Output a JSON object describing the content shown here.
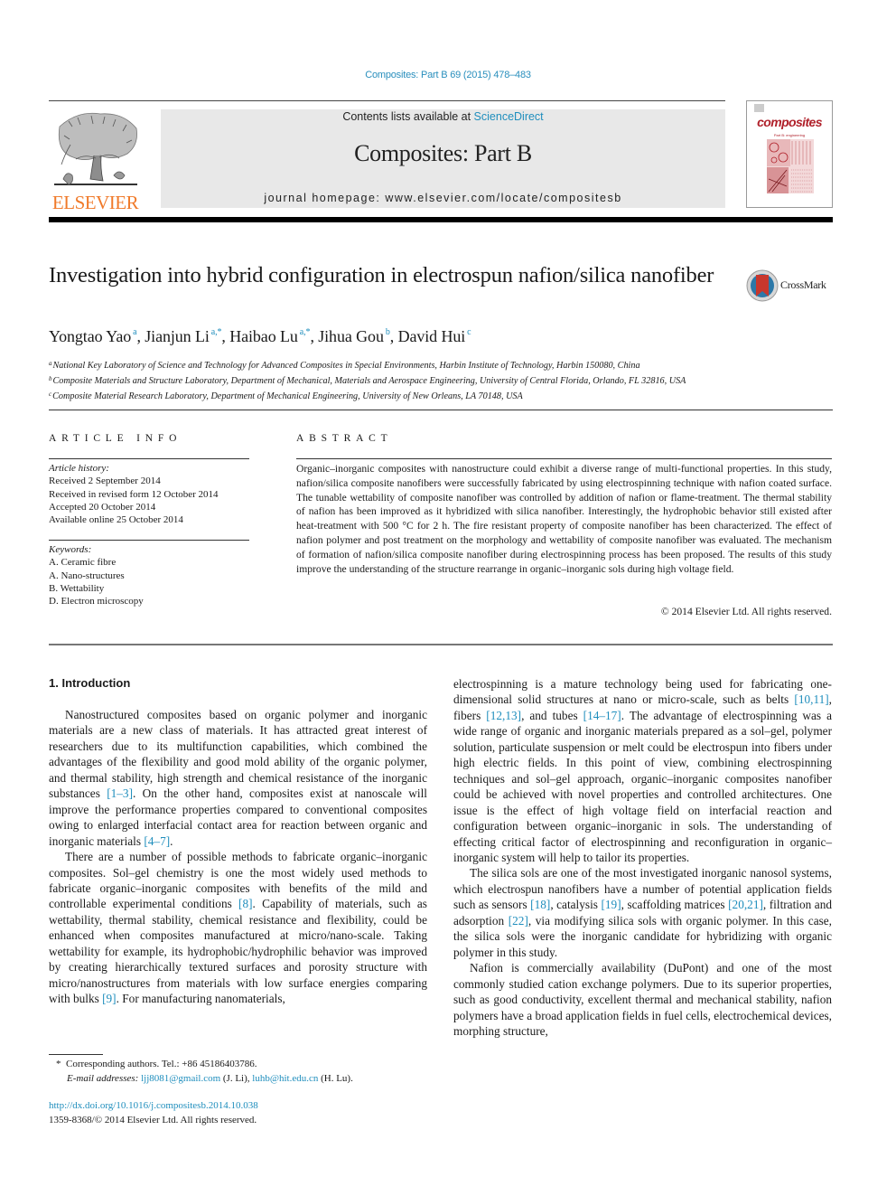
{
  "journal_ref": "Composites: Part B 69 (2015) 478–483",
  "header": {
    "publisher_logo_label": "ELSEVIER",
    "contents_prefix": "Contents lists available at ",
    "contents_link": "ScienceDirect",
    "journal_title": "Composites: Part B",
    "homepage": "journal homepage: www.elsevier.com/locate/compositesb",
    "cover_title": "composites",
    "cover_subtitle": "Part B: engineering"
  },
  "colors": {
    "link": "#1f8ebd",
    "elsevier_orange": "#f07a2a",
    "header_gray": "#e8e8e8",
    "cover_red": "#b0202a"
  },
  "article": {
    "title": "Investigation into hybrid configuration in electrospun nafion/silica nanofiber",
    "crossmark_label": "CrossMark",
    "authors": [
      {
        "name": "Yongtao Yao",
        "sup": "a"
      },
      {
        "name": "Jianjun Li",
        "sup": "a,*"
      },
      {
        "name": "Haibao Lu",
        "sup": "a,*"
      },
      {
        "name": "Jihua Gou",
        "sup": "b"
      },
      {
        "name": "David Hui",
        "sup": "c"
      }
    ],
    "affiliations": [
      {
        "key": "a",
        "text": "National Key Laboratory of Science and Technology for Advanced Composites in Special Environments, Harbin Institute of Technology, Harbin 150080, China"
      },
      {
        "key": "b",
        "text": "Composite Materials and Structure Laboratory, Department of Mechanical, Materials and Aerospace Engineering, University of Central Florida, Orlando, FL 32816, USA"
      },
      {
        "key": "c",
        "text": "Composite Material Research Laboratory, Department of Mechanical Engineering, University of New Orleans, LA 70148, USA"
      }
    ]
  },
  "article_info": {
    "heading": "ARTICLE INFO",
    "history_label": "Article history:",
    "history": [
      "Received 2 September 2014",
      "Received in revised form 12 October 2014",
      "Accepted 20 October 2014",
      "Available online 25 October 2014"
    ],
    "keywords_label": "Keywords:",
    "keywords": [
      "A. Ceramic fibre",
      "A. Nano-structures",
      "B. Wettability",
      "D. Electron microscopy"
    ]
  },
  "abstract": {
    "heading": "ABSTRACT",
    "text": "Organic–inorganic composites with nanostructure could exhibit a diverse range of multi-functional properties. In this study, nafion/silica composite nanofibers were successfully fabricated by using electrospinning technique with nafion coated surface. The tunable wettability of composite nanofiber was controlled by addition of nafion or flame-treatment. The thermal stability of nafion has been improved as it hybridized with silica nanofiber. Interestingly, the hydrophobic behavior still existed after heat-treatment with 500 °C for 2 h. The fire resistant property of composite nanofiber has been characterized. The effect of nafion polymer and post treatment on the morphology and wettability of composite nanofiber was evaluated. The mechanism of formation of nafion/silica composite nanofiber during electrospinning process has been proposed. The results of this study improve the understanding of the structure rearrange in organic–inorganic sols during high voltage field.",
    "copyright": "© 2014 Elsevier Ltd. All rights reserved."
  },
  "body": {
    "section_heading": "1. Introduction",
    "left": {
      "p1": [
        "Nanostructured composites based on organic polymer and inorganic materials are a new class of materials. It has attracted great interest of researchers due to its multifunction capabilities, which combined the advantages of the flexibility and good mold ability of the organic polymer, and thermal stability, high strength and chemical resistance of the inorganic substances ",
        "[1–3]",
        ". On the other hand, composites exist at nanoscale will improve the performance properties compared to conventional composites owing to enlarged interfacial contact area for reaction between organic and inorganic materials ",
        "[4–7]",
        "."
      ],
      "p2": [
        "There are a number of possible methods to fabricate organic–inorganic composites. Sol–gel chemistry is one the most widely used methods to fabricate organic–inorganic composites with benefits of the mild and controllable experimental conditions ",
        "[8]",
        ". Capability of materials, such as wettability, thermal stability, chemical resistance and flexibility, could be enhanced when composites manufactured at micro/nano-scale. Taking wettability for example, its hydrophobic/hydrophilic behavior was improved by creating hierarchically textured surfaces and porosity structure with micro/nanostructures from materials with low surface energies comparing with bulks ",
        "[9]",
        ". For manufacturing nanomaterials,"
      ]
    },
    "right": {
      "p1": [
        "electrospinning is a mature technology being used for fabricating one-dimensional solid structures at nano or micro-scale, such as belts ",
        "[10,11]",
        ", fibers ",
        "[12,13]",
        ", and tubes ",
        "[14–17]",
        ". The advantage of electrospinning was a wide range of organic and inorganic materials prepared as a sol–gel, polymer solution, particulate suspension or melt could be electrospun into fibers under high electric fields. In this point of view, combining electrospinning techniques and sol–gel approach, organic–inorganic composites nanofiber could be achieved with novel properties and controlled architectures. One issue is the effect of high voltage field on interfacial reaction and configuration between organic–inorganic in sols. The understanding of effecting critical factor of electrospinning and reconfiguration in organic–inorganic system will help to tailor its properties."
      ],
      "p2": [
        "The silica sols are one of the most investigated inorganic nanosol systems, which electrospun nanofibers have a number of potential application fields such as sensors ",
        "[18]",
        ", catalysis ",
        "[19]",
        ", scaffolding matrices ",
        "[20,21]",
        ", filtration and adsorption ",
        "[22]",
        ", via modifying silica sols with organic polymer. In this case, the silica sols were the inorganic candidate for hybridizing with organic polymer in this study."
      ],
      "p3": [
        "Nafion is commercially availability (DuPont) and one of the most commonly studied cation exchange polymers. Due to its superior properties, such as good conductivity, excellent thermal and mechanical stability, nafion polymers have a broad application fields in fuel cells, electrochemical devices, morphing structure,"
      ]
    }
  },
  "footnotes": {
    "star": "*",
    "corresponding": "Corresponding authors. Tel.: +86 45186403786.",
    "email_label": "E-mail addresses: ",
    "email1": "ljj8081@gmail.com",
    "email1_owner": " (J. Li), ",
    "email2": "luhb@hit.edu.cn",
    "email2_owner": " (H. Lu).",
    "doi": "http://dx.doi.org/10.1016/j.compositesb.2014.10.038",
    "issn_copyright": "1359-8368/© 2014 Elsevier Ltd. All rights reserved."
  }
}
